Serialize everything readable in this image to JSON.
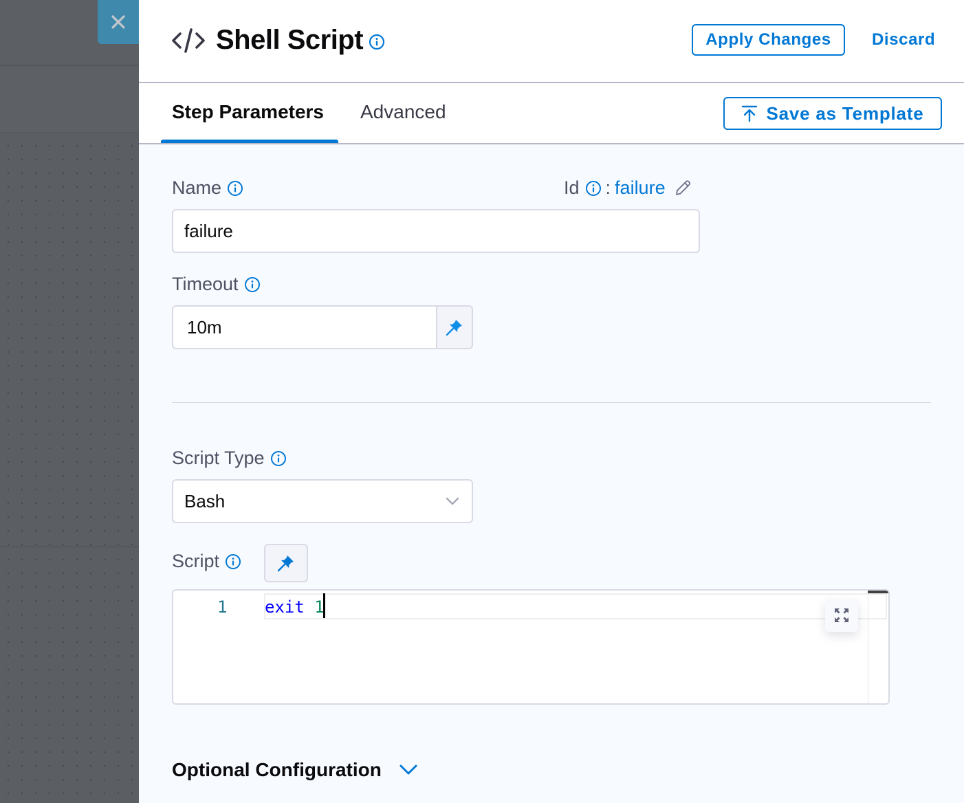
{
  "backdrop": {
    "close_icon": "close-icon"
  },
  "header": {
    "icon": "code-icon",
    "title": "Shell Script",
    "title_info_icon": "info-icon",
    "apply_label": "Apply Changes",
    "discard_label": "Discard"
  },
  "tabs": {
    "items": [
      {
        "label": "Step Parameters",
        "active": true
      },
      {
        "label": "Advanced",
        "active": false
      }
    ],
    "save_template_label": "Save as Template",
    "save_template_icon": "upload-icon"
  },
  "form": {
    "name": {
      "label": "Name",
      "value": "failure"
    },
    "id": {
      "label": "Id",
      "separator": ":",
      "value": "failure",
      "edit_icon": "pencil-icon"
    },
    "timeout": {
      "label": "Timeout",
      "value": "10m",
      "pin_icon": "pin-icon"
    },
    "script_type": {
      "label": "Script Type",
      "selected": "Bash"
    },
    "script": {
      "label": "Script",
      "pin_icon": "pin-icon",
      "lines": [
        {
          "number": "1",
          "keyword": "exit",
          "argument": "1"
        }
      ],
      "expand_icon": "expand-icon"
    },
    "optional_configuration": {
      "label": "Optional Configuration",
      "expanded": false
    }
  },
  "colors": {
    "accent": "#0278d5",
    "title_text": "#0b0b0d",
    "label_text": "#4f5162",
    "close_button": "#3f89ac",
    "panel_background": "#f7fbff"
  }
}
